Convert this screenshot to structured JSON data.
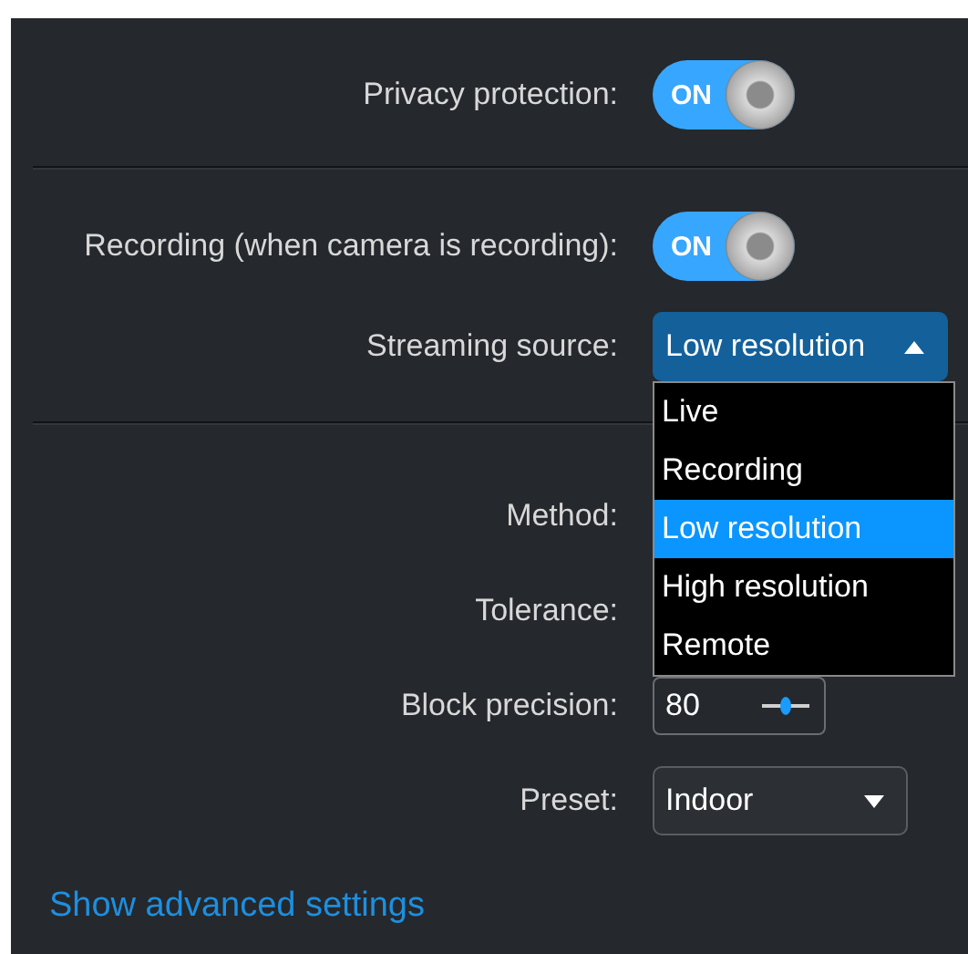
{
  "sections": [
    {
      "rows": [
        {
          "kind": "toggle",
          "label": "Privacy protection:",
          "on": true,
          "text": "ON"
        }
      ]
    },
    {
      "rows": [
        {
          "kind": "toggle",
          "label": "Recording (when camera is recording):",
          "on": true,
          "text": "ON"
        },
        {
          "kind": "select",
          "label": "Streaming source:",
          "value": "Low resolution",
          "expanded": true,
          "options": [
            {
              "label": "Live",
              "selected": false
            },
            {
              "label": "Recording",
              "selected": false
            },
            {
              "label": "Low resolution",
              "selected": true
            },
            {
              "label": "High resolution",
              "selected": false
            },
            {
              "label": "Remote",
              "selected": false
            }
          ]
        }
      ]
    },
    {
      "rows": [
        {
          "kind": "hidden",
          "label": "Method:"
        },
        {
          "kind": "hidden",
          "label": "Tolerance:"
        },
        {
          "kind": "number",
          "label": "Block precision:",
          "value": "80"
        },
        {
          "kind": "select",
          "label": "Preset:",
          "value": "Indoor",
          "expanded": false
        }
      ]
    }
  ],
  "link": "Show advanced settings"
}
